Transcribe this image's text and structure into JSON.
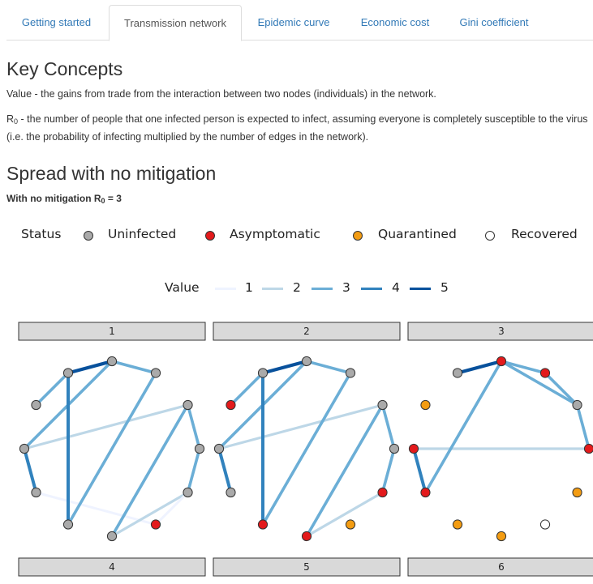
{
  "tabs": [
    {
      "label": "Getting started",
      "active": false
    },
    {
      "label": "Transmission network",
      "active": true
    },
    {
      "label": "Epidemic curve",
      "active": false
    },
    {
      "label": "Economic cost",
      "active": false
    },
    {
      "label": "Gini coefficient",
      "active": false
    }
  ],
  "key_concepts": {
    "title": "Key Concepts",
    "value_text": "Value - the gains from trade from the interaction between two nodes (individuals) in the network.",
    "r0_prefix": "R",
    "r0_sub": "0",
    "r0_text": " - the number of people that one infected person is expected to infect, assuming everyone is completely susceptible to the virus (i.e. the probability of infecting multiplied by the number of edges in the network)."
  },
  "section": {
    "title": "Spread with no mitigation",
    "subtitle_prefix": "With no mitigation R",
    "subtitle_sub": "0",
    "subtitle_suffix": " = 3"
  },
  "status_legend": {
    "title": "Status",
    "items": [
      {
        "label": "Uninfected",
        "color": "#aaaaaa"
      },
      {
        "label": "Asymptomatic",
        "color": "#e31a1c"
      },
      {
        "label": "Quarantined",
        "color": "#f39c12"
      },
      {
        "label": "Recovered",
        "color": "#ffffff"
      }
    ]
  },
  "value_legend": {
    "title": "Value",
    "items": [
      {
        "label": "1",
        "color": "#eff3ff"
      },
      {
        "label": "2",
        "color": "#bdd7e7"
      },
      {
        "label": "3",
        "color": "#6baed6"
      },
      {
        "label": "4",
        "color": "#3182bd"
      },
      {
        "label": "5",
        "color": "#08519c"
      }
    ]
  },
  "chart_data": {
    "type": "network",
    "panels": [
      {
        "label": "1",
        "nodes": [
          "Uninfected",
          "Uninfected",
          "Uninfected",
          "Uninfected",
          "Asymptomatic",
          "Uninfected",
          "Uninfected",
          "Uninfected",
          "Uninfected",
          "Uninfected",
          "Uninfected",
          "Uninfected"
        ],
        "edges": [
          [
            0,
            1,
            4
          ],
          [
            0,
            7,
            2
          ],
          [
            0,
            9,
            3
          ],
          [
            1,
            4,
            1
          ],
          [
            2,
            10,
            4
          ],
          [
            2,
            8,
            3
          ],
          [
            3,
            5,
            2
          ],
          [
            3,
            7,
            3
          ],
          [
            4,
            5,
            1
          ],
          [
            5,
            6,
            3
          ],
          [
            6,
            7,
            3
          ],
          [
            8,
            9,
            3
          ],
          [
            9,
            10,
            5
          ],
          [
            10,
            11,
            3
          ]
        ]
      },
      {
        "label": "2",
        "nodes": [
          "Uninfected",
          "Uninfected",
          "Asymptomatic",
          "Asymptomatic",
          "Quarantined",
          "Asymptomatic",
          "Uninfected",
          "Uninfected",
          "Uninfected",
          "Uninfected",
          "Uninfected",
          "Asymptomatic"
        ],
        "edges": [
          [
            0,
            1,
            4
          ],
          [
            0,
            7,
            2
          ],
          [
            0,
            9,
            3
          ],
          [
            2,
            10,
            4
          ],
          [
            2,
            8,
            3
          ],
          [
            3,
            5,
            2
          ],
          [
            3,
            7,
            3
          ],
          [
            5,
            6,
            3
          ],
          [
            6,
            7,
            3
          ],
          [
            8,
            9,
            3
          ],
          [
            9,
            10,
            5
          ],
          [
            10,
            11,
            3
          ]
        ]
      },
      {
        "label": "3",
        "nodes": [
          "Asymptomatic",
          "Asymptomatic",
          "Quarantined",
          "Quarantined",
          "Recovered",
          "Quarantined",
          "Asymptomatic",
          "Uninfected",
          "Asymptomatic",
          "Asymptomatic",
          "Uninfected",
          "Quarantined"
        ],
        "edges": [
          [
            0,
            1,
            4
          ],
          [
            0,
            6,
            2
          ],
          [
            1,
            9,
            3
          ],
          [
            7,
            9,
            3
          ],
          [
            6,
            7,
            3
          ],
          [
            7,
            8,
            3
          ],
          [
            8,
            9,
            3
          ],
          [
            9,
            10,
            5
          ]
        ]
      },
      {
        "label": "4"
      },
      {
        "label": "5"
      },
      {
        "label": "6"
      }
    ]
  }
}
